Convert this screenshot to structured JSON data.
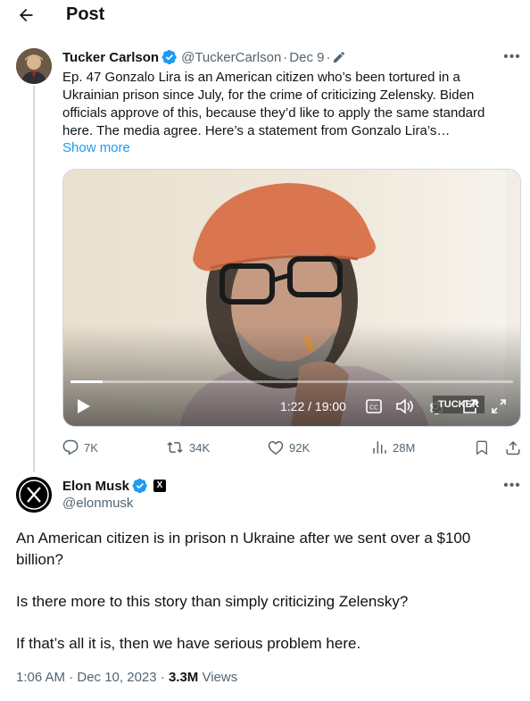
{
  "header": {
    "title": "Post"
  },
  "tweet1": {
    "author_name": "Tucker Carlson",
    "handle": "@TuckerCarlson",
    "separator": "·",
    "date": "Dec 9",
    "text_line1": "Ep. 47  Gonzalo Lira is an American citizen who’s been tortured in a",
    "text_line2": "Ukrainian prison since July, for the crime of criticizing Zelensky. Biden",
    "text_line3": "officials approve of this, because they’d like to apply the same standard",
    "text_line4": "here. The media agree. Here’s a statement from Gonzalo Lira’s…",
    "show_more": "Show more",
    "video": {
      "time": "1:22 / 19:00",
      "progress_fraction": 0.072,
      "watermark": "TUCKER"
    },
    "replies": "7K",
    "reposts": "34K",
    "likes": "92K",
    "views": "28M"
  },
  "tweet2": {
    "author_name": "Elon Musk",
    "handle": "@elonmusk",
    "badge": "X",
    "para1_line1": "An American citizen is in prison n Ukraine after we sent over a $100",
    "para1_line2": "billion?",
    "para2": "Is there more to this story than simply criticizing Zelensky?",
    "para3": "If that’s all it is, then we have serious problem here.",
    "timestamp": "1:06 AM · Dec 10, 2023 · ",
    "views_count": "3.3M",
    "views_label": " Views"
  },
  "colors": {
    "accent": "#1d9bf0",
    "muted_text": "#536471",
    "main_text": "#0f1419",
    "thread_line": "#cfd9de"
  },
  "icons": {
    "back": "arrow-left-icon",
    "verified": "verified-badge-icon",
    "more": "more-dots-icon",
    "play": "play-icon",
    "captions": "captions-icon",
    "volume": "volume-icon",
    "settings": "gear-icon",
    "popout": "popout-icon",
    "fullscreen": "fullscreen-icon",
    "reply": "reply-icon",
    "repost": "repost-icon",
    "like": "heart-icon",
    "views": "views-chart-icon",
    "bookmark": "bookmark-icon",
    "share": "share-icon"
  }
}
